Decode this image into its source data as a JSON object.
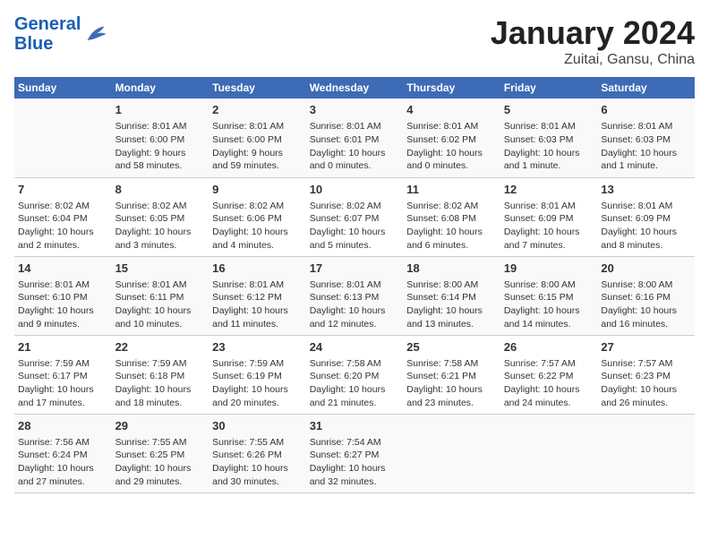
{
  "logo": {
    "text_general": "General",
    "text_blue": "Blue"
  },
  "title": "January 2024",
  "subtitle": "Zuitai, Gansu, China",
  "weekdays": [
    "Sunday",
    "Monday",
    "Tuesday",
    "Wednesday",
    "Thursday",
    "Friday",
    "Saturday"
  ],
  "weeks": [
    [
      {
        "day": "",
        "info": ""
      },
      {
        "day": "1",
        "info": "Sunrise: 8:01 AM\nSunset: 6:00 PM\nDaylight: 9 hours\nand 58 minutes."
      },
      {
        "day": "2",
        "info": "Sunrise: 8:01 AM\nSunset: 6:00 PM\nDaylight: 9 hours\nand 59 minutes."
      },
      {
        "day": "3",
        "info": "Sunrise: 8:01 AM\nSunset: 6:01 PM\nDaylight: 10 hours\nand 0 minutes."
      },
      {
        "day": "4",
        "info": "Sunrise: 8:01 AM\nSunset: 6:02 PM\nDaylight: 10 hours\nand 0 minutes."
      },
      {
        "day": "5",
        "info": "Sunrise: 8:01 AM\nSunset: 6:03 PM\nDaylight: 10 hours\nand 1 minute."
      },
      {
        "day": "6",
        "info": "Sunrise: 8:01 AM\nSunset: 6:03 PM\nDaylight: 10 hours\nand 1 minute."
      }
    ],
    [
      {
        "day": "7",
        "info": "Sunrise: 8:02 AM\nSunset: 6:04 PM\nDaylight: 10 hours\nand 2 minutes."
      },
      {
        "day": "8",
        "info": "Sunrise: 8:02 AM\nSunset: 6:05 PM\nDaylight: 10 hours\nand 3 minutes."
      },
      {
        "day": "9",
        "info": "Sunrise: 8:02 AM\nSunset: 6:06 PM\nDaylight: 10 hours\nand 4 minutes."
      },
      {
        "day": "10",
        "info": "Sunrise: 8:02 AM\nSunset: 6:07 PM\nDaylight: 10 hours\nand 5 minutes."
      },
      {
        "day": "11",
        "info": "Sunrise: 8:02 AM\nSunset: 6:08 PM\nDaylight: 10 hours\nand 6 minutes."
      },
      {
        "day": "12",
        "info": "Sunrise: 8:01 AM\nSunset: 6:09 PM\nDaylight: 10 hours\nand 7 minutes."
      },
      {
        "day": "13",
        "info": "Sunrise: 8:01 AM\nSunset: 6:09 PM\nDaylight: 10 hours\nand 8 minutes."
      }
    ],
    [
      {
        "day": "14",
        "info": "Sunrise: 8:01 AM\nSunset: 6:10 PM\nDaylight: 10 hours\nand 9 minutes."
      },
      {
        "day": "15",
        "info": "Sunrise: 8:01 AM\nSunset: 6:11 PM\nDaylight: 10 hours\nand 10 minutes."
      },
      {
        "day": "16",
        "info": "Sunrise: 8:01 AM\nSunset: 6:12 PM\nDaylight: 10 hours\nand 11 minutes."
      },
      {
        "day": "17",
        "info": "Sunrise: 8:01 AM\nSunset: 6:13 PM\nDaylight: 10 hours\nand 12 minutes."
      },
      {
        "day": "18",
        "info": "Sunrise: 8:00 AM\nSunset: 6:14 PM\nDaylight: 10 hours\nand 13 minutes."
      },
      {
        "day": "19",
        "info": "Sunrise: 8:00 AM\nSunset: 6:15 PM\nDaylight: 10 hours\nand 14 minutes."
      },
      {
        "day": "20",
        "info": "Sunrise: 8:00 AM\nSunset: 6:16 PM\nDaylight: 10 hours\nand 16 minutes."
      }
    ],
    [
      {
        "day": "21",
        "info": "Sunrise: 7:59 AM\nSunset: 6:17 PM\nDaylight: 10 hours\nand 17 minutes."
      },
      {
        "day": "22",
        "info": "Sunrise: 7:59 AM\nSunset: 6:18 PM\nDaylight: 10 hours\nand 18 minutes."
      },
      {
        "day": "23",
        "info": "Sunrise: 7:59 AM\nSunset: 6:19 PM\nDaylight: 10 hours\nand 20 minutes."
      },
      {
        "day": "24",
        "info": "Sunrise: 7:58 AM\nSunset: 6:20 PM\nDaylight: 10 hours\nand 21 minutes."
      },
      {
        "day": "25",
        "info": "Sunrise: 7:58 AM\nSunset: 6:21 PM\nDaylight: 10 hours\nand 23 minutes."
      },
      {
        "day": "26",
        "info": "Sunrise: 7:57 AM\nSunset: 6:22 PM\nDaylight: 10 hours\nand 24 minutes."
      },
      {
        "day": "27",
        "info": "Sunrise: 7:57 AM\nSunset: 6:23 PM\nDaylight: 10 hours\nand 26 minutes."
      }
    ],
    [
      {
        "day": "28",
        "info": "Sunrise: 7:56 AM\nSunset: 6:24 PM\nDaylight: 10 hours\nand 27 minutes."
      },
      {
        "day": "29",
        "info": "Sunrise: 7:55 AM\nSunset: 6:25 PM\nDaylight: 10 hours\nand 29 minutes."
      },
      {
        "day": "30",
        "info": "Sunrise: 7:55 AM\nSunset: 6:26 PM\nDaylight: 10 hours\nand 30 minutes."
      },
      {
        "day": "31",
        "info": "Sunrise: 7:54 AM\nSunset: 6:27 PM\nDaylight: 10 hours\nand 32 minutes."
      },
      {
        "day": "",
        "info": ""
      },
      {
        "day": "",
        "info": ""
      },
      {
        "day": "",
        "info": ""
      }
    ]
  ]
}
